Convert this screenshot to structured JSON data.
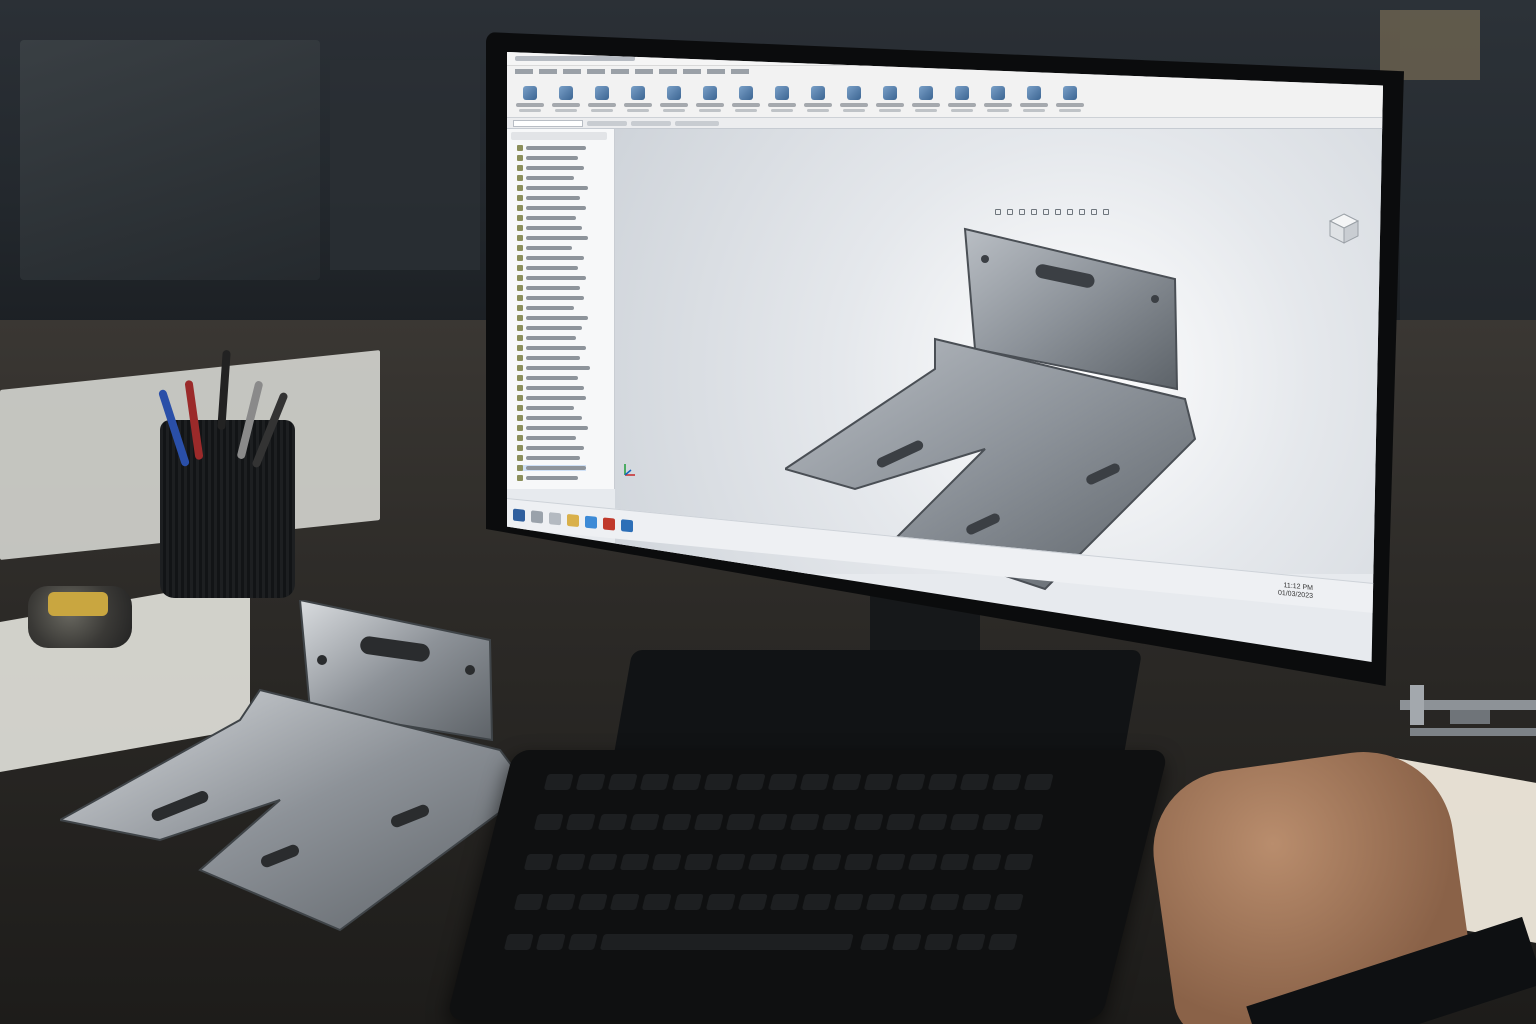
{
  "taskbar": {
    "clock_time": "11:12 PM",
    "clock_date": "01/03/2023"
  },
  "colors": {
    "accent": "#2f5f9e",
    "ribbon": "#f2f2f2",
    "viewport": "#e7eaee",
    "part_metal": "#8d9298"
  },
  "icons": [
    "minimize-icon",
    "maximize-icon",
    "close-icon",
    "view-cube-icon",
    "start-icon",
    "search-icon",
    "triad-icon"
  ]
}
